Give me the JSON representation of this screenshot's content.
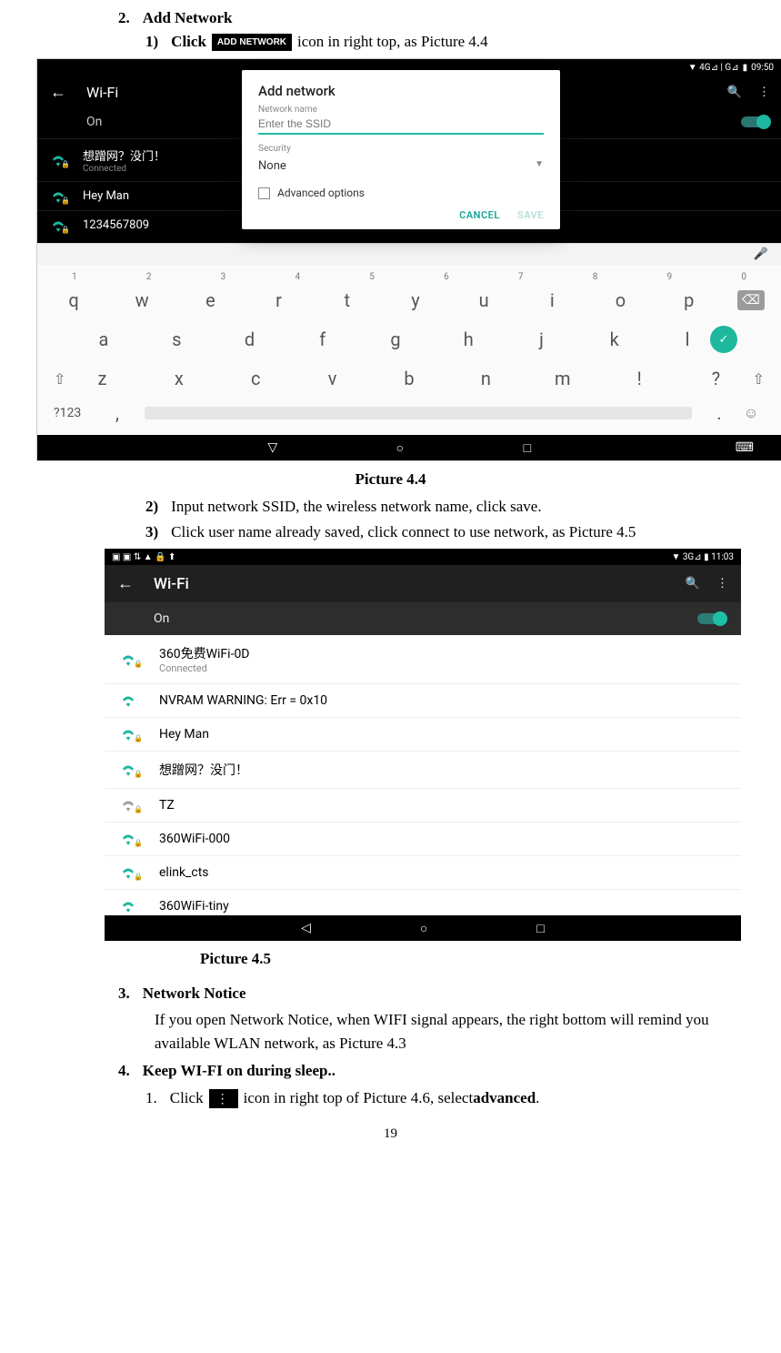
{
  "heading2": {
    "num": "2.",
    "title": "Add Network"
  },
  "step1": {
    "num": "1)",
    "prefix": "Click",
    "btn": "ADD NETWORK",
    "suffix": " icon in right top, as Picture 4.4"
  },
  "shot44": {
    "status": {
      "signal": "▼ 4G⊿ | G⊿ ",
      "batt": "▮",
      "time": "09:50"
    },
    "screenTitle": "Wi-Fi",
    "onLabel": "On",
    "networks": [
      {
        "name": "想蹭网？没门！",
        "status": "Connected",
        "locked": true
      },
      {
        "name": "Hey Man",
        "status": "",
        "locked": true
      },
      {
        "name": "1234567809",
        "status": "",
        "locked": true
      }
    ],
    "dialog": {
      "title": "Add network",
      "label_name": "Network name",
      "placeholder": "Enter the SSID",
      "label_security": "Security",
      "security_value": "None",
      "adv": "Advanced options",
      "cancel": "CANCEL",
      "save": "SAVE"
    },
    "kbd": {
      "nums": [
        "1",
        "2",
        "3",
        "4",
        "5",
        "6",
        "7",
        "8",
        "9",
        "0"
      ],
      "row1": [
        "q",
        "w",
        "e",
        "r",
        "t",
        "y",
        "u",
        "i",
        "o",
        "p"
      ],
      "row2": [
        "a",
        "s",
        "d",
        "f",
        "g",
        "h",
        "j",
        "k",
        "l"
      ],
      "row3": [
        "z",
        "x",
        "c",
        "v",
        "b",
        "n",
        "m",
        "!",
        "?"
      ],
      "sym": "?123"
    }
  },
  "caption44": "Picture 4.4",
  "step2": {
    "num": "2)",
    "text": "Input network SSID, the wireless network name, click save."
  },
  "step3": {
    "num": "3)",
    "text": "Click user name already saved, click connect to use network, as Picture 4.5"
  },
  "shot45": {
    "sbleft": "▣ ▣ ⇅ ▲ 🔒 ⬆",
    "sright": "▼ 3G⊿ ▮ 11:03",
    "title": "Wi-Fi",
    "on": "On",
    "rows": [
      {
        "ssid": "360免费WiFi-0D",
        "sub": "Connected",
        "locked": true,
        "strong": true
      },
      {
        "ssid": "NVRAM WARNING: Err = 0x10",
        "sub": "",
        "locked": false,
        "strong": true
      },
      {
        "ssid": "Hey Man",
        "sub": "",
        "locked": true,
        "strong": true
      },
      {
        "ssid": "想蹭网？没门！",
        "sub": "",
        "locked": true,
        "strong": true
      },
      {
        "ssid": "TZ",
        "sub": "",
        "locked": true,
        "strong": false
      },
      {
        "ssid": "360WiFi-000",
        "sub": "",
        "locked": true,
        "strong": true
      },
      {
        "ssid": "elink_cts",
        "sub": "",
        "locked": true,
        "strong": true
      },
      {
        "ssid": "360WiFi-tiny",
        "sub": "",
        "locked": false,
        "strong": true
      }
    ]
  },
  "caption45": "Picture 4.5",
  "heading3": {
    "num": "3.",
    "title": "Network Notice"
  },
  "para3": "If you open Network Notice, when WIFI signal appears, the right bottom will remind you available WLAN network, as Picture 4.3",
  "heading4": {
    "num": "4.",
    "title": "Keep WI-FI on during sleep.."
  },
  "step4_1": {
    "num": "1.",
    "prefix": "Click",
    "menu": "⋮",
    "suffix_a": " icon in right top of Picture 4.6, select ",
    "adv": "advanced",
    "tail": "."
  },
  "pagenum": "19"
}
